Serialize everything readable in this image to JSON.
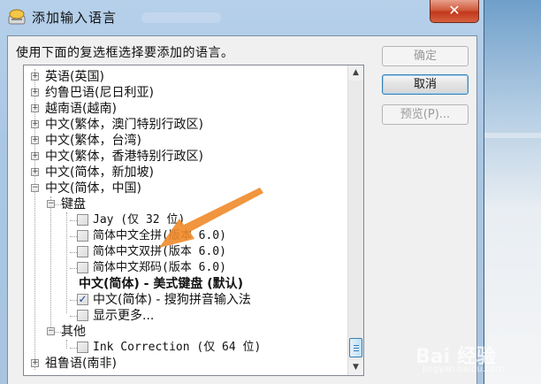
{
  "window": {
    "title": "添加输入语言",
    "close_glyph": "✕"
  },
  "instruction": "使用下面的复选框选择要添加的语言。",
  "buttons": {
    "ok": "确定",
    "cancel": "取消",
    "preview": "预览(P)..."
  },
  "tree": [
    {
      "label": "英语(英国)"
    },
    {
      "label": "约鲁巴语(尼日利亚)"
    },
    {
      "label": "越南语(越南)"
    },
    {
      "label": "中文(繁体，澳门特别行政区)"
    },
    {
      "label": "中文(繁体，台湾)"
    },
    {
      "label": "中文(繁体，香港特别行政区)"
    },
    {
      "label": "中文(简体，新加坡)"
    },
    {
      "label": "中文(简体，中国)"
    },
    {
      "label": "键盘"
    },
    {
      "label": "Jay (仅 32 位)"
    },
    {
      "label": "简体中文全拼(版本 6.0)"
    },
    {
      "label": "简体中文双拼(版本 6.0)"
    },
    {
      "label": "简体中文郑码(版本 6.0)"
    },
    {
      "label": "中文(简体) - 美式键盘 (默认)"
    },
    {
      "label": "中文(简体) - 搜狗拼音输入法"
    },
    {
      "label": "显示更多..."
    },
    {
      "label": "其他"
    },
    {
      "label": "Ink Correction (仅 64 位)"
    },
    {
      "label": "祖鲁语(南非)"
    }
  ],
  "glyphs": {
    "expand": "+",
    "collapse": "−",
    "check": "✓",
    "scroll_up": "▲",
    "scroll_down": "▼"
  },
  "icons": {
    "title": "keyboard-input-icon",
    "arrow": "orange-pointer-arrow"
  },
  "colors": {
    "accent": "#3c7fb1",
    "close": "#c2381d",
    "arrow": "#f08a2a"
  },
  "watermark": {
    "brand": "Bai 经验",
    "url": "jingyan.baidu.com"
  }
}
